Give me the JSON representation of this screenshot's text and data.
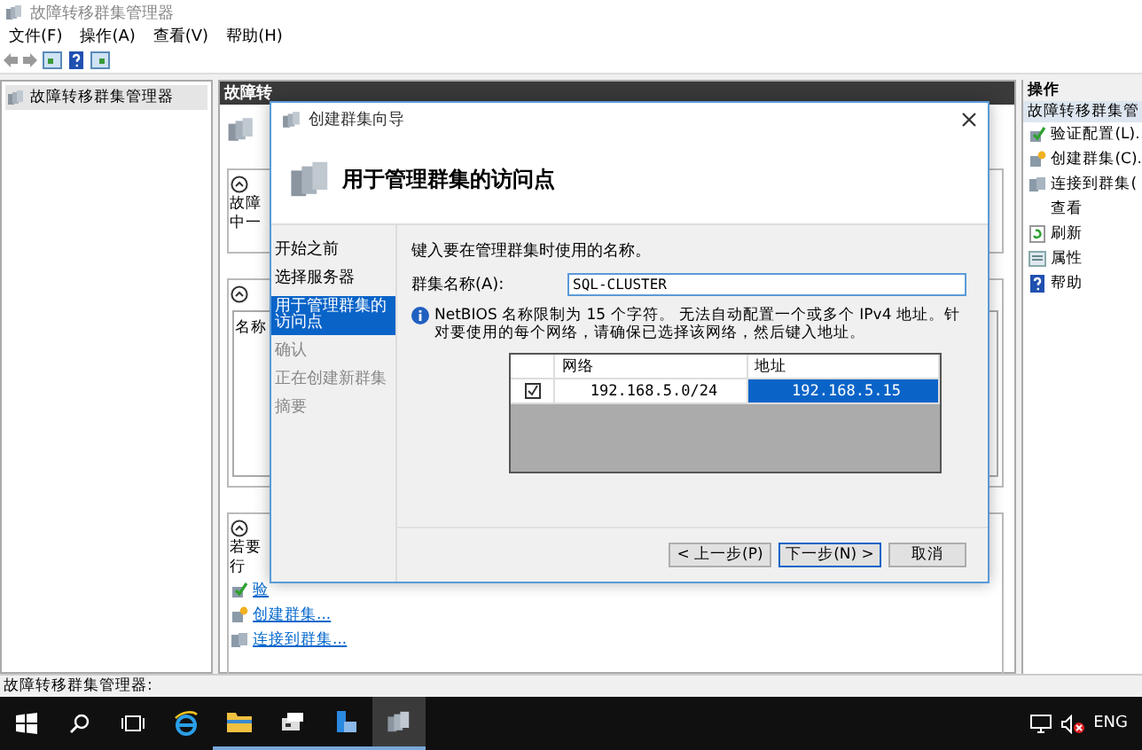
{
  "window": {
    "title": "故障转移群集管理器"
  },
  "menu": [
    "文件(F)",
    "操作(A)",
    "查看(V)",
    "帮助(H)"
  ],
  "tree": {
    "items": [
      {
        "label": "故障转移群集管理器",
        "selected": true
      }
    ]
  },
  "center": {
    "header": "故障转",
    "sections": [
      {
        "lines": [
          "故障",
          "中一"
        ]
      },
      {
        "column": "名称"
      },
      {
        "lines": [
          "若要",
          "行"
        ],
        "links": [
          {
            "label": "验",
            "kind": "check"
          },
          {
            "label": "创建群集...",
            "kind": "star"
          },
          {
            "label": "连接到群集...",
            "kind": "server"
          }
        ]
      }
    ]
  },
  "actions": {
    "header": "操作",
    "group": {
      "label": "故障转移群集管",
      "selected": true
    },
    "items": [
      {
        "label": "验证配置(L).",
        "kind": "check"
      },
      {
        "label": "创建群集(C).",
        "kind": "star"
      },
      {
        "label": "连接到群集(",
        "kind": "server"
      },
      {
        "label": "查看",
        "kind": "plain"
      },
      {
        "label": "刷新",
        "kind": "refresh"
      },
      {
        "label": "属性",
        "kind": "props"
      },
      {
        "label": "帮助",
        "kind": "help"
      }
    ]
  },
  "status_bar": "故障转移群集管理器:",
  "taskbar": {
    "language": "ENG"
  },
  "dialog": {
    "title": "创建群集向导",
    "heading": "用于管理群集的访问点",
    "steps": [
      {
        "label": "开始之前",
        "selected": false,
        "disabled": false
      },
      {
        "label": "选择服务器",
        "selected": false,
        "disabled": false
      },
      {
        "label": "用于管理群集的访问点",
        "selected": true,
        "disabled": false
      },
      {
        "label": "确认",
        "selected": false,
        "disabled": true
      },
      {
        "label": "正在创建新群集",
        "selected": false,
        "disabled": true
      },
      {
        "label": "摘要",
        "selected": false,
        "disabled": true
      }
    ],
    "prompt": "键入要在管理群集时使用的名称。",
    "name_label": "群集名称(A):",
    "name_value": "SQL-CLUSTER",
    "info": "NetBIOS 名称限制为 15 个字符。 无法自动配置一个或多个 IPv4 地址。针对要使用的每个网络，请确保已选择该网络，然后键入地址。",
    "table": {
      "columns": [
        "网络",
        "地址"
      ],
      "rows": [
        {
          "checked": true,
          "network": "192.168.5.0/24",
          "address": "192.168.5.15",
          "selected": true
        }
      ]
    },
    "buttons": [
      {
        "label": "< 上一步(P)",
        "default": false
      },
      {
        "label": "下一步(N) >",
        "default": true
      },
      {
        "label": "取消",
        "default": false
      }
    ]
  }
}
